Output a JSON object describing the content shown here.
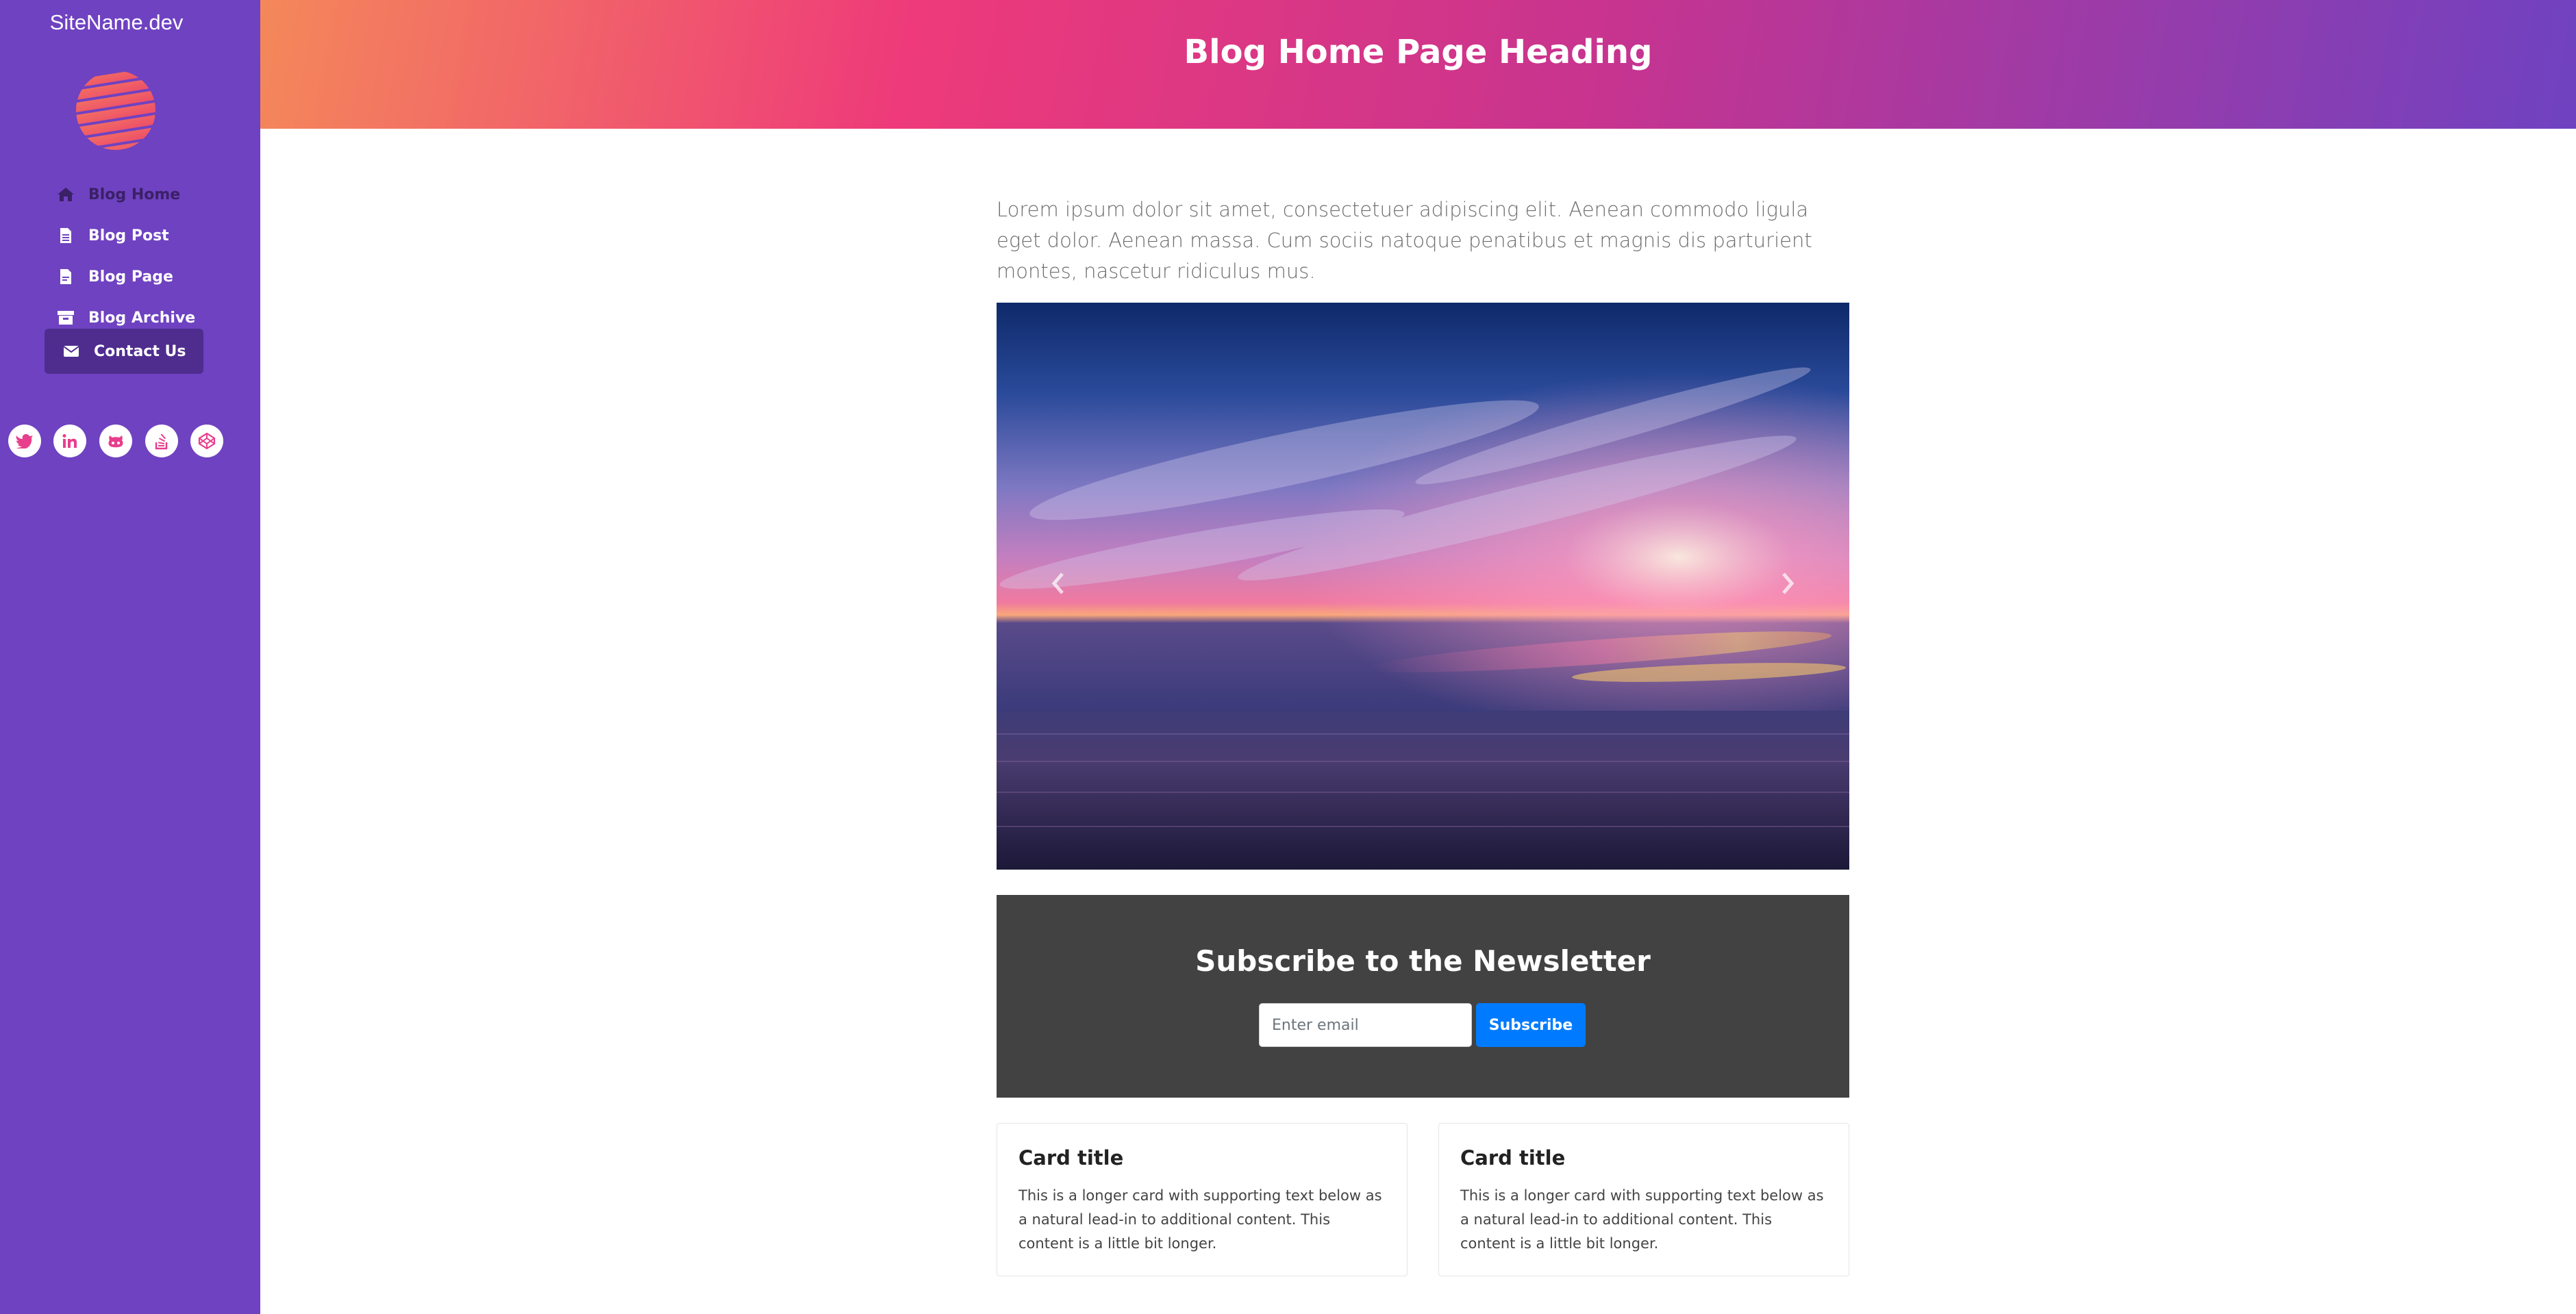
{
  "sidebar": {
    "site_name": "SiteName.dev",
    "logo_icon": "striped-globe-logo",
    "nav": [
      {
        "label": "Blog Home",
        "icon": "home-icon"
      },
      {
        "label": "Blog Post",
        "icon": "file-icon"
      },
      {
        "label": "Blog Page",
        "icon": "file-alt-icon"
      },
      {
        "label": "Blog Archive",
        "icon": "archive-icon"
      },
      {
        "label": "Contact Us",
        "icon": "envelope-icon"
      }
    ],
    "social": [
      "twitter-icon",
      "linkedin-icon",
      "github-icon",
      "stack-overflow-icon",
      "codepen-icon"
    ]
  },
  "header": {
    "title": "Blog Home Page Heading"
  },
  "main": {
    "intro": "Lorem ipsum dolor sit amet, consectetuer adipiscing elit. Aenean commodo ligula eget dolor. Aenean massa. Cum sociis natoque penatibus et magnis dis parturient montes, nascetur ridiculus mus.",
    "carousel": {
      "image": "sunset-over-sea",
      "prev_icon": "chevron-left-icon",
      "next_icon": "chevron-right-icon"
    },
    "newsletter": {
      "title": "Subscribe to the Newsletter",
      "placeholder": "Enter email",
      "button": "Subscribe"
    },
    "cards": [
      {
        "title": "Card title",
        "text": "This is a longer card with supporting text below as a natural lead-in to additional content. This content is a little bit longer."
      },
      {
        "title": "Card title",
        "text": "This is a longer card with supporting text below as a natural lead-in to additional content. This content is a little bit longer."
      }
    ]
  },
  "colors": {
    "sidebar": "#6f42c1",
    "header_gradient": [
      "#f4885a",
      "#ee3a7a",
      "#c7348f",
      "#6f42c1"
    ],
    "newsletter_bg": "#424242",
    "subscribe_button": "#007bff",
    "social_icon": "#e83e8c"
  }
}
